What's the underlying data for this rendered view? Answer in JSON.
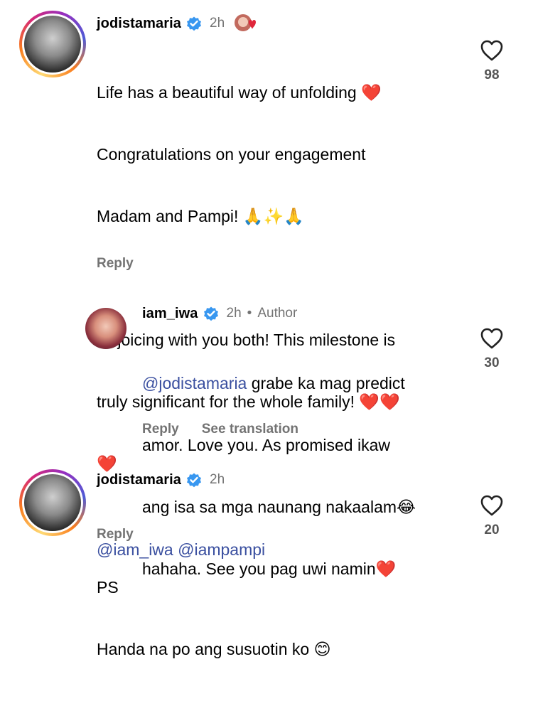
{
  "comments": [
    {
      "username": "jodistamaria",
      "time": "2h",
      "lines": [
        "Life has a beautiful way of unfolding ❤️",
        "Congratulations on your engagement",
        "Madam and Pampi! 🙏✨🙏",
        "",
        "Rejoicing with you both! This milestone is",
        "truly significant for the whole family! ❤️❤️",
        "❤️",
        "",
        "PS",
        "Handa na po ang susuotin ko 😊"
      ],
      "reply": "Reply",
      "likes": "98"
    },
    {
      "username": "iam_iwa",
      "time": "2h",
      "separator": "•",
      "author_label": "Author",
      "mention": "@jodistamaria",
      "text_first": " grabe ka mag predict",
      "lines_rest": [
        "amor. Love you. As promised ikaw",
        "ang isa sa mga naunang nakaalam😂",
        "hahaha. See you pag uwi namin❤️"
      ],
      "reply": "Reply",
      "see_translation": "See translation",
      "likes": "30"
    },
    {
      "username": "jodistamaria",
      "time": "2h",
      "mention_1": "@iam_iwa",
      "mention_2": "@iampampi",
      "reply": "Reply",
      "likes": "20"
    }
  ],
  "colors": {
    "verified": "#3897f0",
    "mention": "#3b50a0",
    "muted": "#737373"
  }
}
